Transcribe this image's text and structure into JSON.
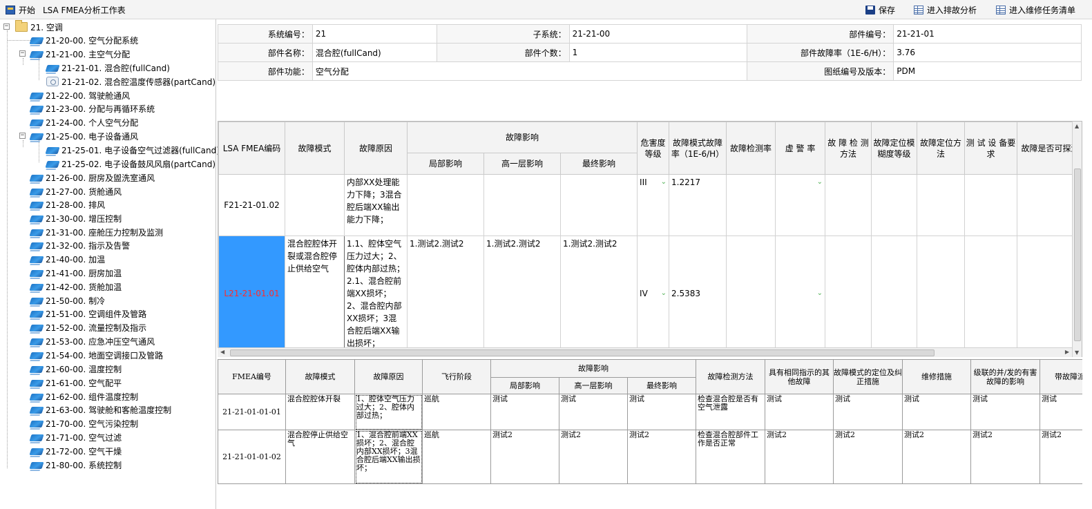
{
  "toolbar": {
    "start_label": "开始",
    "title": "LSA FMEA分析工作表",
    "save_label": "保存",
    "troubleshoot_label": "进入排故分析",
    "maintenance_label": "进入维修任务清单"
  },
  "tree": {
    "root": "21. 空调",
    "n2020": "21-20-00. 空气分配系统",
    "n2121": "21-21-00. 主空气分配",
    "n212101": "21-21-01. 混合腔(fullCand)",
    "n212102": "21-21-02. 混合腔温度传感器(partCand)",
    "n2122": "21-22-00. 驾驶舱通风",
    "n2123": "21-23-00. 分配与再循环系统",
    "n2124": "21-24-00. 个人空气分配",
    "n2125": "21-25-00. 电子设备通风",
    "n212501": "21-25-01. 电子设备空气过滤器(fullCand)",
    "n212502": "21-25-02. 电子设备鼓风风扇(partCand)",
    "n2126": "21-26-00. 厨房及盥洗室通风",
    "n2127": "21-27-00. 货舱通风",
    "n2128": "21-28-00. 排风",
    "n2130": "21-30-00. 增压控制",
    "n2131": "21-31-00. 座舱压力控制及监测",
    "n2132": "21-32-00. 指示及告警",
    "n2140": "21-40-00. 加温",
    "n2141": "21-41-00. 厨房加温",
    "n2142": "21-42-00. 货舱加温",
    "n2150": "21-50-00. 制冷",
    "n2151": "21-51-00. 空调组件及管路",
    "n2152": "21-52-00. 流量控制及指示",
    "n2153": "21-53-00. 应急冲压空气通风",
    "n2154": "21-54-00. 地面空调接口及管路",
    "n2160": "21-60-00. 温度控制",
    "n2161": "21-61-00. 空气配平",
    "n2162": "21-62-00. 组件温度控制",
    "n2163": "21-63-00. 驾驶舱和客舱温度控制",
    "n2170": "21-70-00. 空气污染控制",
    "n2171": "21-71-00. 空气过滤",
    "n2172": "21-72-00. 空气干燥",
    "n2180": "21-80-00. 系统控制"
  },
  "info": {
    "sys_no_label": "系统编号：",
    "sys_no": "21",
    "subsys_label": "子系统：",
    "subsys": "21-21-00",
    "part_no_label": "部件编号：",
    "part_no": "21-21-01",
    "part_name_label": "部件名称：",
    "part_name": "混合腔(fullCand)",
    "part_count_label": "部件个数：",
    "part_count": "1",
    "part_rate_label": "部件故障率（1E-6/H）：",
    "part_rate": "3.76",
    "part_func_label": "部件功能：",
    "part_func": "空气分配",
    "drawing_label": "图纸编号及版本：",
    "drawing": "PDM"
  },
  "grid1": {
    "h_code": "LSA FMEA编码",
    "h_mode": "故障模式",
    "h_cause": "故障原因",
    "h_effect": "故障影响",
    "h_local": "局部影响",
    "h_higher": "高一层影响",
    "h_final": "最终影响",
    "h_severity": "危害度等级",
    "h_rate": "故障模式故障率（1E-6/H）",
    "h_detect": "故障检测率",
    "h_false": "虚 警 率",
    "h_method": "故 障 检 测 方法",
    "h_ambiguity": "故障定位模糊度等级",
    "h_locate": "故障定位方法",
    "h_equipment": "测 试 设 备要求",
    "h_explore": "故障是否可探测",
    "rows": [
      {
        "code": "F21-21-01.02",
        "mode": "",
        "cause": "内部XX处理能力下降；3混合腔后端XX输出能力下降；",
        "local": "",
        "higher": "",
        "final": "",
        "severity": "III",
        "rate": "1.2217"
      },
      {
        "code": "L21-21-01.01",
        "mode": "混合腔腔体开裂或混合腔停止供给空气",
        "cause": "1.1、腔体空气压力过大；2、腔体内部过热；2.1、混合腔前端XX损坏；2、混合腔内部XX损坏；3混合腔后端XX输出损坏；",
        "local": "1.测试2.测试2",
        "higher": "1.测试2.测试2",
        "final": "1.测试2.测试2",
        "severity": "IV",
        "rate": "2.5383"
      }
    ]
  },
  "grid2": {
    "h_code": "FMEA编号",
    "h_mode": "故障模式",
    "h_cause": "故障原因",
    "h_phase": "飞行阶段",
    "h_effect": "故障影响",
    "h_local": "局部影响",
    "h_higher": "高一层影响",
    "h_final": "最终影响",
    "h_detect": "故障检测方法",
    "h_same": "具有相同指示的其他故障",
    "h_locate": "故障模式的定位及纠正措施",
    "h_repair": "维修措施",
    "h_cascade": "级联的并/发的有害故障的影响",
    "h_latent": "带故障派遣",
    "rows": [
      {
        "code": "21-21-01-01-01",
        "mode": "混合腔腔体开裂",
        "cause": "1、腔体空气压力过大；2、腔体内部过热；",
        "phase": "巡航",
        "local": "测试",
        "higher": "测试",
        "final": "测试",
        "detect": "检查混合腔是否有空气泄露",
        "same": "测试",
        "locate": "测试",
        "repair": "测试",
        "cascade": "测试",
        "latent": "测试"
      },
      {
        "code": "21-21-01-01-02",
        "mode": "混合腔停止供给空气",
        "cause": "1、混合腔前端XX损坏；2、混合腔内部XX损坏；3混合腔后端XX输出损坏；",
        "phase": "巡航",
        "local": "测试2",
        "higher": "测试2",
        "final": "测试2",
        "detect": "检查混合腔部件工作是否正常",
        "same": "测试2",
        "locate": "测试2",
        "repair": "测试2",
        "cascade": "测试2",
        "latent": "测试2"
      }
    ]
  }
}
